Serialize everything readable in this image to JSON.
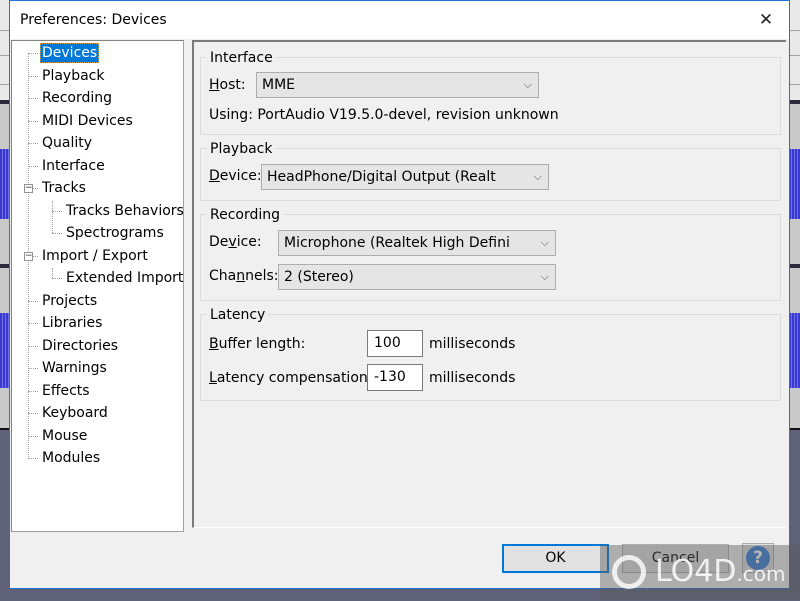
{
  "dialog": {
    "title": "Preferences: Devices",
    "close_glyph": "✕"
  },
  "tree": {
    "items": [
      {
        "label": "Devices",
        "level": 0,
        "selected": true
      },
      {
        "label": "Playback",
        "level": 0
      },
      {
        "label": "Recording",
        "level": 0
      },
      {
        "label": "MIDI Devices",
        "level": 0
      },
      {
        "label": "Quality",
        "level": 0
      },
      {
        "label": "Interface",
        "level": 0
      },
      {
        "label": "Tracks",
        "level": 0,
        "expanded": true
      },
      {
        "label": "Tracks Behaviors",
        "level": 1
      },
      {
        "label": "Spectrograms",
        "level": 1
      },
      {
        "label": "Import / Export",
        "level": 0,
        "expanded": true
      },
      {
        "label": "Extended Import",
        "level": 1
      },
      {
        "label": "Projects",
        "level": 0
      },
      {
        "label": "Libraries",
        "level": 0
      },
      {
        "label": "Directories",
        "level": 0
      },
      {
        "label": "Warnings",
        "level": 0
      },
      {
        "label": "Effects",
        "level": 0
      },
      {
        "label": "Keyboard",
        "level": 0
      },
      {
        "label": "Mouse",
        "level": 0
      },
      {
        "label": "Modules",
        "level": 0
      }
    ],
    "collapse_glyph": "−"
  },
  "interface": {
    "group_label": "Interface",
    "host_label_u": "H",
    "host_label_rest": "ost:",
    "host_value": "MME",
    "using_text": "Using: PortAudio V19.5.0-devel, revision unknown"
  },
  "playback": {
    "group_label": "Playback",
    "device_label_u": "D",
    "device_label_rest": "evice:",
    "device_value": "HeadPhone/Digital Output (Realt"
  },
  "recording": {
    "group_label": "Recording",
    "device_label_pre": "De",
    "device_label_u": "v",
    "device_label_post": "ice:",
    "device_value": "Microphone (Realtek High Defini",
    "channels_label_pre": "Cha",
    "channels_label_u": "n",
    "channels_label_post": "nels:",
    "channels_value": "2 (Stereo)"
  },
  "latency": {
    "group_label": "Latency",
    "buffer_label_u": "B",
    "buffer_label_rest": "uffer length:",
    "buffer_value": "100",
    "buffer_unit": "milliseconds",
    "comp_label_u": "L",
    "comp_label_rest": "atency compensation:",
    "comp_value": "-130",
    "comp_unit": "milliseconds"
  },
  "buttons": {
    "ok": "OK",
    "cancel": "Cancel",
    "help": "?"
  },
  "chevron_glyph": "⌵",
  "watermark": {
    "text": "LO4D",
    "suffix": ".com"
  },
  "colors": {
    "accent": "#0078d7",
    "dialog_bg": "#f0f0f0",
    "selected_bg": "#0078d7"
  }
}
